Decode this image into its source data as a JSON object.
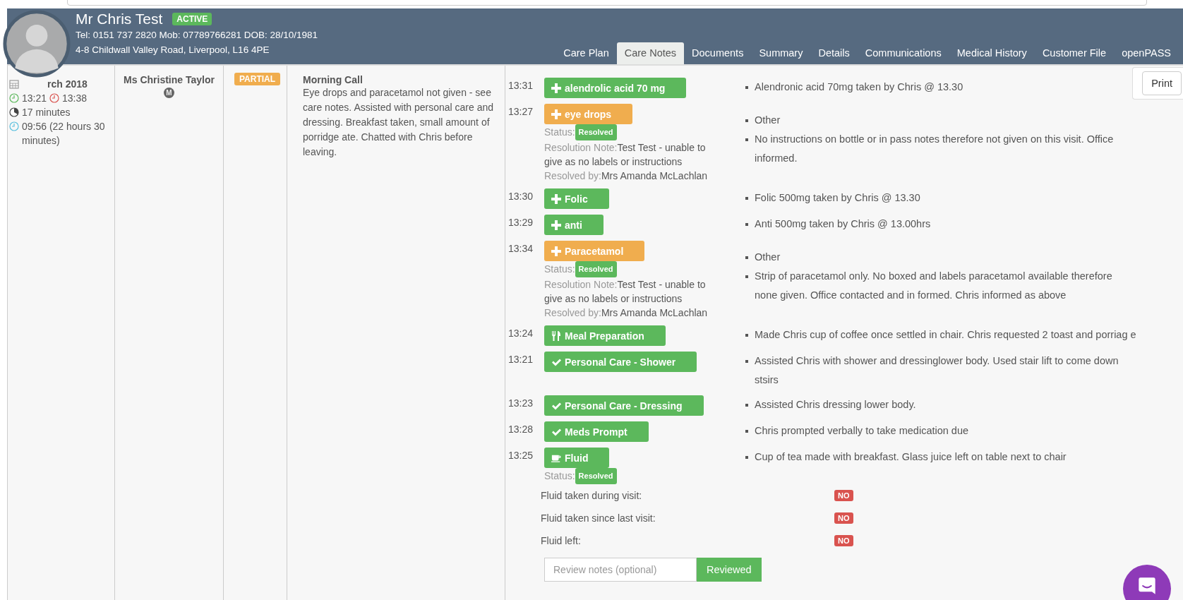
{
  "client": {
    "name": "Mr Chris Test",
    "status": "ACTIVE",
    "contact": "Tel: 0151 737 2820 Mob: 07789766281 DOB: 28/10/1981",
    "address": "4-8 Childwall Valley Road, Liverpool, L16 4PE"
  },
  "tabs": [
    {
      "label": "Care Plan",
      "selected": false
    },
    {
      "label": "Care Notes",
      "selected": true
    },
    {
      "label": "Documents",
      "selected": false
    },
    {
      "label": "Summary",
      "selected": false
    },
    {
      "label": "Details",
      "selected": false
    },
    {
      "label": "Communications",
      "selected": false
    },
    {
      "label": "Medical History",
      "selected": false
    },
    {
      "label": "Customer File",
      "selected": false
    },
    {
      "label": "openPASS",
      "selected": false
    }
  ],
  "print_button": "Print",
  "visit": {
    "date": "rch 2018",
    "start": "13:21",
    "end": "13:38",
    "duration": "17 minutes",
    "scheduled": "09:56 (22 hours 30 minutes)",
    "carer": "Ms Christine Taylor",
    "carer_badge": "M",
    "status": "PARTIAL",
    "call_title": "Morning Call",
    "summary": "Eye drops and paracetamol not given - see care notes. Assisted with personal care and dressing. Breakfast taken, small amount of porridge ate. Chatted with Chris before leaving."
  },
  "tasks": [
    {
      "time": "13:31",
      "kind": "medication",
      "label": "alendrolic acid 70 mg",
      "color": "#5cb85c",
      "notes": [
        "Alendronic acid 70mg taken by Chris @ 13.30"
      ]
    },
    {
      "time": "13:27",
      "kind": "medication",
      "label": "eye drops",
      "color": "#f0ad4e",
      "status_label": "Status:",
      "status": "Resolved",
      "resolution": {
        "note_label": "Resolution Note:",
        "note": "Test Test - unable to give as no labels or instructions",
        "by_label": "Resolved by:",
        "by": "Mrs Amanda McLachlan"
      },
      "notes": [
        "Other",
        "No instructions on bottle or in pass notes therefore not given on this visit. Office informed."
      ]
    },
    {
      "time": "13:30",
      "kind": "medication",
      "label": "Folic",
      "color": "#5cb85c",
      "notes": [
        "Folic 500mg taken by Chris @ 13.30"
      ]
    },
    {
      "time": "13:29",
      "kind": "medication",
      "label": "anti",
      "color": "#5cb85c",
      "notes": [
        "Anti 500mg taken by Chris @ 13.00hrs"
      ]
    },
    {
      "time": "13:34",
      "kind": "medication",
      "label": "Paracetamol",
      "color": "#f0ad4e",
      "status_label": "Status:",
      "status": "Resolved",
      "resolution": {
        "note_label": "Resolution Note:",
        "note": "Test Test - unable to give as no labels or instructions",
        "by_label": "Resolved by:",
        "by": "Mrs Amanda McLachlan"
      },
      "notes": [
        "Other",
        "Strip of paracetamol only. No boxed and labels paracetamol available therefore none given. Office contacted and in formed. Chris informed as above"
      ]
    },
    {
      "time": "13:24",
      "kind": "meal",
      "label": "Meal Preparation",
      "color": "#5cb85c",
      "notes": [
        "Made Chris cup of coffee once settled in chair. Chris requested 2 toast and porriag e"
      ]
    },
    {
      "time": "13:21",
      "kind": "care",
      "label": "Personal Care - Shower",
      "color": "#5cb85c",
      "notes": [
        "Assisted Chris with shower and dressinglower body. Used stair lift to come down stsirs"
      ]
    },
    {
      "time": "13:23",
      "kind": "care",
      "label": "Personal Care - Dressing",
      "color": "#5cb85c",
      "notes": [
        "Assisted Chris dressing lower body."
      ]
    },
    {
      "time": "13:28",
      "kind": "care",
      "label": "Meds Prompt",
      "color": "#5cb85c",
      "notes": [
        "Chris prompted verbally to take medication due"
      ]
    },
    {
      "time": "13:25",
      "kind": "fluid",
      "label": "Fluid",
      "color": "#5cb85c",
      "status_label": "Status:",
      "status": "Resolved",
      "notes": [
        "Cup of tea made with breakfast. Glass juice left on table next to chair"
      ],
      "checks": [
        {
          "label": "Fluid taken during visit:",
          "value": "NO"
        },
        {
          "label": "Fluid taken since last visit:",
          "value": "NO"
        },
        {
          "label": "Fluid left:",
          "value": "NO"
        }
      ]
    }
  ],
  "review": {
    "placeholder": "Review notes (optional)",
    "button": "Reviewed"
  }
}
